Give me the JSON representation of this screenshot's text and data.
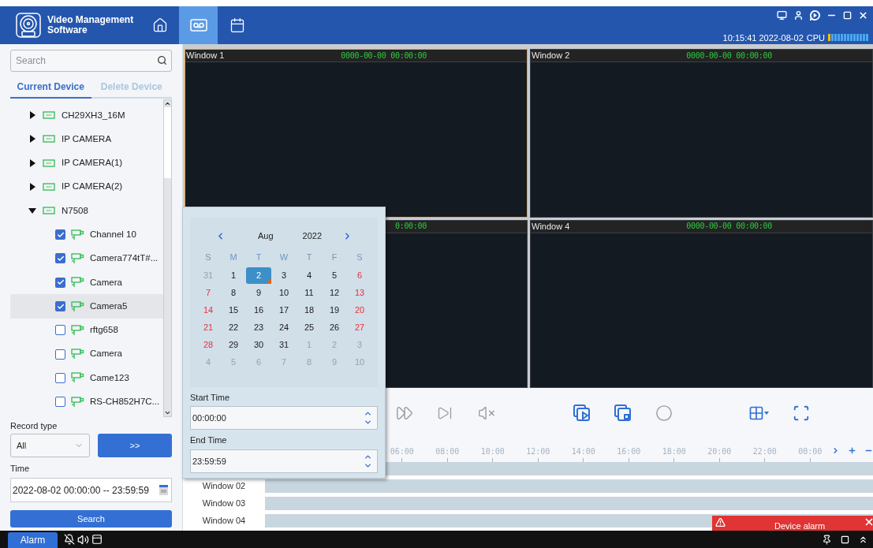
{
  "header": {
    "app_title": "Video Management Software",
    "nav": [
      {
        "kind": "home",
        "selected": false
      },
      {
        "kind": "playback",
        "selected": true
      },
      {
        "kind": "schedule",
        "selected": false
      }
    ],
    "clock": "10:15:41 2022-08-02",
    "cpu_label": "CPU",
    "cpu": {
      "level": 0.1
    }
  },
  "sidebar": {
    "search": {
      "placeholder": "Search"
    },
    "tabs": [
      {
        "label": "Current Device",
        "selected": true
      },
      {
        "label": "Delete Device",
        "selected": false
      }
    ],
    "tree": [
      {
        "label": "CH29XH3_16M",
        "expanded": false,
        "selected": false
      },
      {
        "label": "IP CAMERA",
        "expanded": false,
        "selected": false
      },
      {
        "label": "IP CAMERA(1)",
        "expanded": false,
        "selected": false
      },
      {
        "label": "IP CAMERA(2)",
        "expanded": false,
        "selected": false
      },
      {
        "label": "N7508",
        "expanded": true,
        "selected": false,
        "children": [
          {
            "label": "Channel 10",
            "checked": true,
            "selected": false
          },
          {
            "label": "Camera774tT#...",
            "checked": true,
            "selected": false
          },
          {
            "label": "Camera",
            "checked": true,
            "selected": false
          },
          {
            "label": "Camera5",
            "checked": true,
            "selected": true
          },
          {
            "label": "rftg658",
            "checked": false,
            "selected": false
          },
          {
            "label": "Camera",
            "checked": false,
            "selected": false
          },
          {
            "label": "Came123",
            "checked": false,
            "selected": false
          },
          {
            "label": "RS-CH852H7C...",
            "checked": false,
            "selected": false
          }
        ]
      }
    ],
    "record_type": {
      "label": "Record type",
      "value": "All"
    },
    "next_button": ">>",
    "time": {
      "label": "Time",
      "value": "2022-08-02 00:00:00 -- 23:59:59"
    },
    "search_button": "Search"
  },
  "windows": [
    {
      "title": "Window 1",
      "time": "0000-00-00 00:00:00",
      "selected": true
    },
    {
      "title": "Window 2",
      "time": "0000-00-00 00:00:00",
      "selected": false
    },
    {
      "time": "0:00:00",
      "selected": false
    },
    {
      "title": "Window 4",
      "time": "0000-00-00 00:00:00",
      "selected": false
    }
  ],
  "timeline": {
    "ticks": [
      "06:00",
      "08:00",
      "10:00",
      "12:00",
      "14:00",
      "16:00",
      "18:00",
      "20:00",
      "22:00",
      "00:00"
    ],
    "row_labels": [
      "Window 02",
      "Window 03",
      "Window 04"
    ]
  },
  "calendar": {
    "month": "Aug",
    "year": "2022",
    "weekdays": [
      "S",
      "M",
      "T",
      "W",
      "T",
      "F",
      "S"
    ],
    "days": [
      {
        "day": "31",
        "kind": "other",
        "selected": false,
        "today": false
      },
      {
        "day": "1",
        "kind": "weekday",
        "selected": false,
        "today": false
      },
      {
        "day": "2",
        "kind": "weekday",
        "selected": true,
        "today": true
      },
      {
        "day": "3",
        "kind": "weekday",
        "selected": false,
        "today": false
      },
      {
        "day": "4",
        "kind": "weekday",
        "selected": false,
        "today": false
      },
      {
        "day": "5",
        "kind": "weekday",
        "selected": false,
        "today": false
      },
      {
        "day": "6",
        "kind": "weekend",
        "selected": false,
        "today": false
      },
      {
        "day": "7",
        "kind": "weekend",
        "selected": false,
        "today": false
      },
      {
        "day": "8",
        "kind": "weekday",
        "selected": false,
        "today": false
      },
      {
        "day": "9",
        "kind": "weekday",
        "selected": false,
        "today": false
      },
      {
        "day": "10",
        "kind": "weekday",
        "selected": false,
        "today": false
      },
      {
        "day": "11",
        "kind": "weekday",
        "selected": false,
        "today": false
      },
      {
        "day": "12",
        "kind": "weekday",
        "selected": false,
        "today": false
      },
      {
        "day": "13",
        "kind": "weekend",
        "selected": false,
        "today": false
      },
      {
        "day": "14",
        "kind": "weekend",
        "selected": false,
        "today": false
      },
      {
        "day": "15",
        "kind": "weekday",
        "selected": false,
        "today": false
      },
      {
        "day": "16",
        "kind": "weekday",
        "selected": false,
        "today": false
      },
      {
        "day": "17",
        "kind": "weekday",
        "selected": false,
        "today": false
      },
      {
        "day": "18",
        "kind": "weekday",
        "selected": false,
        "today": false
      },
      {
        "day": "19",
        "kind": "weekday",
        "selected": false,
        "today": false
      },
      {
        "day": "20",
        "kind": "weekend",
        "selected": false,
        "today": false
      },
      {
        "day": "21",
        "kind": "weekend",
        "selected": false,
        "today": false
      },
      {
        "day": "22",
        "kind": "weekday",
        "selected": false,
        "today": false
      },
      {
        "day": "23",
        "kind": "weekday",
        "selected": false,
        "today": false
      },
      {
        "day": "24",
        "kind": "weekday",
        "selected": false,
        "today": false
      },
      {
        "day": "25",
        "kind": "weekday",
        "selected": false,
        "today": false
      },
      {
        "day": "26",
        "kind": "weekday",
        "selected": false,
        "today": false
      },
      {
        "day": "27",
        "kind": "weekend",
        "selected": false,
        "today": false
      },
      {
        "day": "28",
        "kind": "weekend",
        "selected": false,
        "today": false
      },
      {
        "day": "29",
        "kind": "weekday",
        "selected": false,
        "today": false
      },
      {
        "day": "30",
        "kind": "weekday",
        "selected": false,
        "today": false
      },
      {
        "day": "31",
        "kind": "weekday",
        "selected": false,
        "today": false
      },
      {
        "day": "1",
        "kind": "other",
        "selected": false,
        "today": false
      },
      {
        "day": "2",
        "kind": "other",
        "selected": false,
        "today": false
      },
      {
        "day": "3",
        "kind": "other",
        "selected": false,
        "today": false
      },
      {
        "day": "4",
        "kind": "other",
        "selected": false,
        "today": false
      },
      {
        "day": "5",
        "kind": "other",
        "selected": false,
        "today": false
      },
      {
        "day": "6",
        "kind": "other",
        "selected": false,
        "today": false
      },
      {
        "day": "7",
        "kind": "other",
        "selected": false,
        "today": false
      },
      {
        "day": "8",
        "kind": "other",
        "selected": false,
        "today": false
      },
      {
        "day": "9",
        "kind": "other",
        "selected": false,
        "today": false
      },
      {
        "day": "10",
        "kind": "other",
        "selected": false,
        "today": false
      }
    ],
    "start_label": "Start Time",
    "start_value": "00:00:00",
    "end_label": "End Time",
    "end_value": "23:59:59"
  },
  "alarm_popup": {
    "text": "Device alarm"
  },
  "taskbar": {
    "alarm_button": "Alarm"
  }
}
